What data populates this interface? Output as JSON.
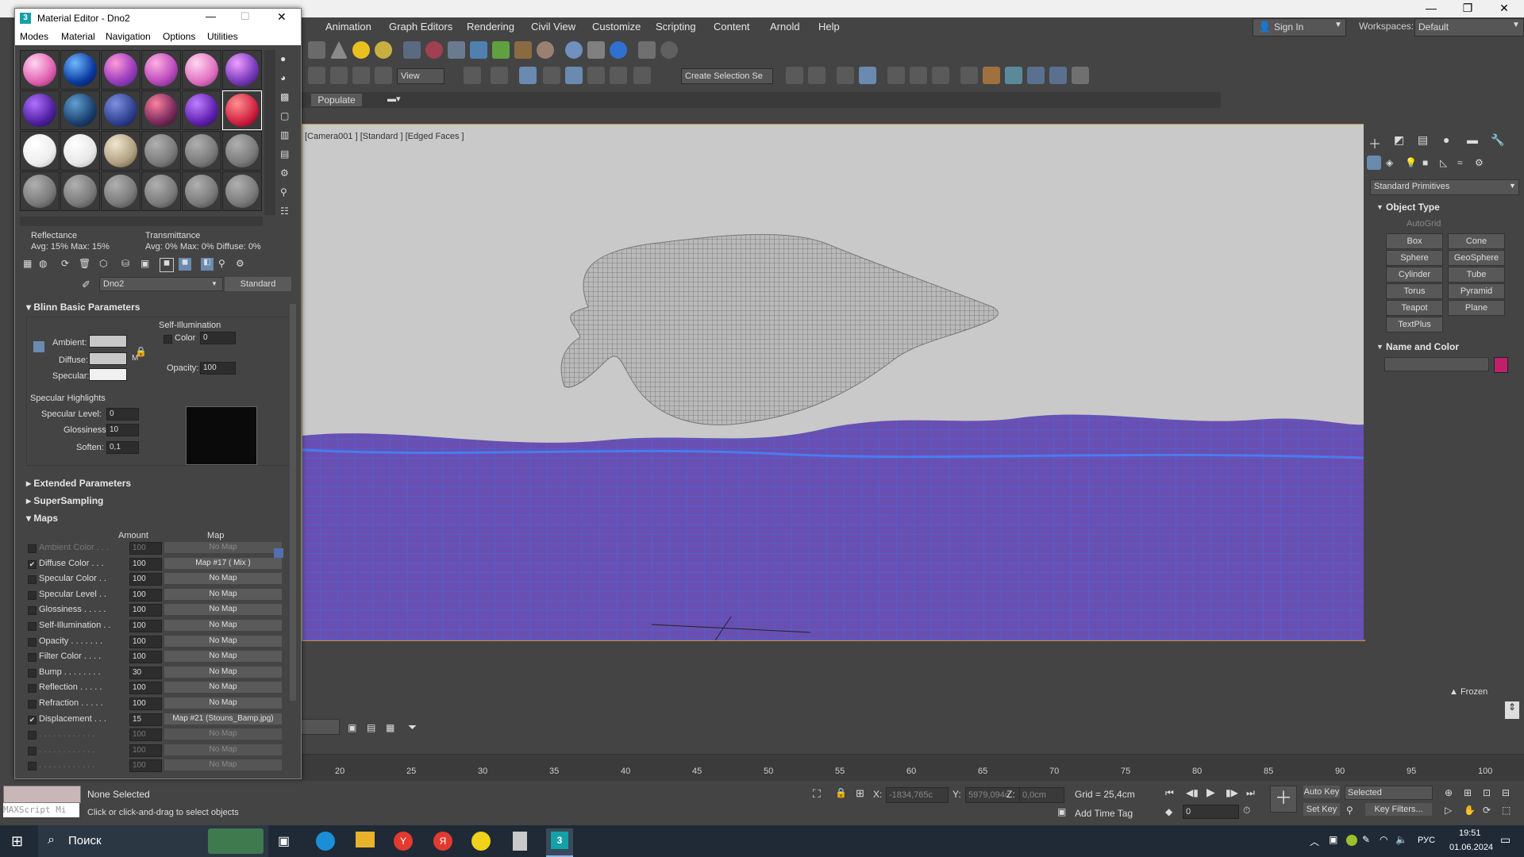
{
  "mated": {
    "title": "Material Editor - Dno2",
    "menu": [
      "Modes",
      "Material",
      "Navigation",
      "Options",
      "Utilities"
    ],
    "reflectance_label": "Reflectance",
    "reflectance_values": "Avg: 15% Max: 15%",
    "transmittance_label": "Transmittance",
    "transmittance_values": "Avg: 0% Max: 0% Diffuse: 0%",
    "material_name": "Dno2",
    "material_type": "Standard",
    "blinn": {
      "title": "Blinn Basic Parameters",
      "self_illum": "Self-Illumination",
      "ambient": "Ambient:",
      "diffuse": "Diffuse:",
      "specular": "Specular:",
      "color": "Color",
      "color_val": "0",
      "opacity": "Opacity:",
      "opacity_val": "100",
      "m": "M",
      "spec_highlights": "Specular Highlights",
      "spec_level": "Specular Level:",
      "spec_level_val": "0",
      "glossiness": "Glossiness:",
      "glossiness_val": "10",
      "soften": "Soften:",
      "soften_val": "0,1"
    },
    "extended": "Extended Parameters",
    "supersampling": "SuperSampling",
    "maps_title": "Maps",
    "amount_hdr": "Amount",
    "map_hdr": "Map",
    "maps": [
      {
        "name": "Ambient Color . . .",
        "amount": "100",
        "map": "No Map",
        "checked": "",
        "dim": true
      },
      {
        "name": "Diffuse Color . . .",
        "amount": "100",
        "map": "Map #17  ( Mix )",
        "checked": "✔",
        "dim": false
      },
      {
        "name": "Specular Color  . .",
        "amount": "100",
        "map": "No Map",
        "checked": "",
        "dim": false
      },
      {
        "name": "Specular Level  . .",
        "amount": "100",
        "map": "No Map",
        "checked": "",
        "dim": false
      },
      {
        "name": "Glossiness . . . . .",
        "amount": "100",
        "map": "No Map",
        "checked": "",
        "dim": false
      },
      {
        "name": "Self-Illumination . .",
        "amount": "100",
        "map": "No Map",
        "checked": "",
        "dim": false
      },
      {
        "name": "Opacity . . . . . . .",
        "amount": "100",
        "map": "No Map",
        "checked": "",
        "dim": false
      },
      {
        "name": "Filter Color  . . . .",
        "amount": "100",
        "map": "No Map",
        "checked": "",
        "dim": false
      },
      {
        "name": "Bump . . . . . . . .",
        "amount": "30",
        "map": "No Map",
        "checked": "",
        "dim": false
      },
      {
        "name": "Reflection  . . . . .",
        "amount": "100",
        "map": "No Map",
        "checked": "",
        "dim": false
      },
      {
        "name": "Refraction  . . . . .",
        "amount": "100",
        "map": "No Map",
        "checked": "",
        "dim": false
      },
      {
        "name": "Displacement . . .",
        "amount": "15",
        "map": "Map #21 (Stouns_Bamp.jpg)",
        "checked": "✔",
        "dim": false
      },
      {
        "name": ". . . . . . . . . . . .",
        "amount": "100",
        "map": "No Map",
        "checked": "",
        "dim": true
      },
      {
        "name": ". . . . . . . . . . . .",
        "amount": "100",
        "map": "No Map",
        "checked": "",
        "dim": true
      },
      {
        "name": ". . . . . . . . . . . .",
        "amount": "100",
        "map": "No Map",
        "checked": "",
        "dim": true
      }
    ]
  },
  "menubar": {
    "items": [
      "Animation",
      "Graph Editors",
      "Rendering",
      "Civil View",
      "Customize",
      "Scripting",
      "Content",
      "Arnold",
      "Help"
    ],
    "sign_in": "Sign In",
    "workspaces_label": "Workspaces:",
    "workspace_value": "Default"
  },
  "toolbar": {
    "view_dd": "View",
    "selection_set": "Create Selection Se",
    "populate": "Populate"
  },
  "viewport": {
    "label": "[Camera001 ] [Standard ] [Edged Faces ]"
  },
  "cmdpanel": {
    "category": "Standard Primitives",
    "object_type": "Object Type",
    "autogrid": "AutoGrid",
    "buttons": [
      "Box",
      "Cone",
      "Sphere",
      "GeoSphere",
      "Cylinder",
      "Tube",
      "Torus",
      "Pyramid",
      "Teapot",
      "Plane",
      "TextPlus"
    ],
    "name_color": "Name and Color",
    "object_color": "#c0206a"
  },
  "timeline": {
    "frozen": "Frozen",
    "ticks": [
      "20",
      "25",
      "30",
      "35",
      "40",
      "45",
      "50",
      "55",
      "60",
      "65",
      "70",
      "75",
      "80",
      "85",
      "90",
      "95",
      "100"
    ]
  },
  "status": {
    "none_selected": "None Selected",
    "prompt": "Click or click-and-drag to select objects",
    "maxscript": "MAXScript Mi",
    "x_label": "X:",
    "x_val": "-1834,765c",
    "y_label": "Y:",
    "y_val": "5979,094c",
    "z_label": "Z:",
    "z_val": "0,0cm",
    "grid": "Grid = 25,4cm",
    "add_time_tag": "Add Time Tag",
    "auto_key": "Auto Key",
    "set_key": "Set Key",
    "selected": "Selected",
    "key_filters": "Key Filters...",
    "frame": "0"
  },
  "taskbar": {
    "search": "Поиск",
    "lang": "РУС",
    "time": "19:51",
    "date": "01.06.2024"
  }
}
